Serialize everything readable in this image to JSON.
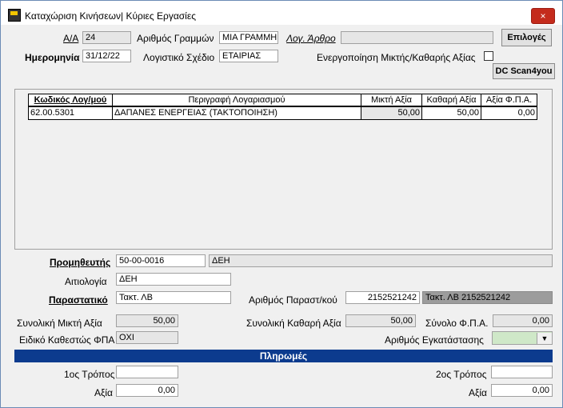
{
  "window": {
    "title": "Καταχώριση Κινήσεων| Κύριες Εργασίες",
    "close_icon": "×"
  },
  "header": {
    "aa_label": "Α/Α",
    "aa_value": "24",
    "line_count_label": "Αριθμός Γραμμών",
    "line_count_value": "ΜΙΑ ΓΡΑΜΜΗ",
    "log_arthro_label": "Λογ. Άρθρο",
    "log_arthro_value": "",
    "options_button": "Επιλογές",
    "date_label": "Ημερομηνία",
    "date_value": "31/12/22",
    "plan_label": "Λογιστικό Σχέδιο",
    "plan_value": "ΕΤΑΙΡΙΑΣ",
    "gross_net_label": "Ενεργοποίηση Μικτής/Καθαρής Αξίας",
    "scan_button": "DC Scan4you"
  },
  "grid": {
    "columns": [
      "Κωδικός Λογ/μού",
      "Περιγραφή Λογαριασμού",
      "Μικτή Αξία",
      "Καθαρή Αξία",
      "Αξία Φ.Π.Α."
    ],
    "rows": [
      {
        "code": "62.00.5301",
        "description": "ΔΑΠΑΝΕΣ ΕΝΕΡΓΕΙΑΣ (ΤΑΚΤΟΠΟΙΗΣΗ)",
        "gross": "50,00",
        "net": "50,00",
        "vat": "0,00"
      }
    ]
  },
  "footer": {
    "supplier_label": "Προμηθευτής",
    "supplier_code": "50-00-0016",
    "supplier_name": "ΔΕΗ",
    "reason_label": "Αιτιολογία",
    "reason_value": "ΔΕΗ",
    "document_label": "Παραστατικό",
    "document_value": "Τακτ. ΛΒ",
    "doc_number_label": "Αριθμός Παραστ/κού",
    "doc_number_value": "2152521242",
    "doc_full_value": "Τακτ. ΛΒ 2152521242",
    "total_gross_label": "Συνολική Μικτή Αξία",
    "total_gross_value": "50,00",
    "total_net_label": "Συνολική Καθαρή Αξία",
    "total_net_value": "50,00",
    "total_vat_label": "Σύνολο Φ.Π.Α.",
    "total_vat_value": "0,00",
    "vat_regime_label": "Ειδικό Καθεστώς ΦΠΑ",
    "vat_regime_value": "ΟΧΙ",
    "installation_label": "Αριθμός Εγκατάστασης",
    "installation_value": ""
  },
  "payments": {
    "title": "Πληρωμές",
    "method1_label": "1ος Τρόπος",
    "method1_value": "",
    "amount1_label": "Αξία",
    "amount1_value": "0,00",
    "method2_label": "2ος Τρόπος",
    "method2_value": "",
    "amount2_label": "Αξία",
    "amount2_value": "0,00"
  }
}
